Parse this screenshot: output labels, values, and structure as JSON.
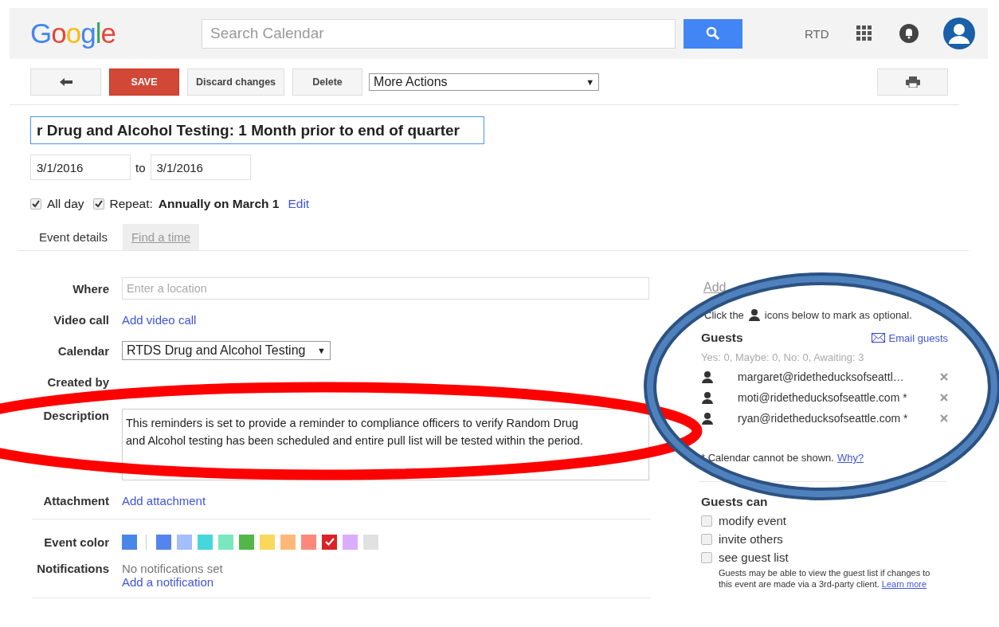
{
  "header": {
    "logo": "Google",
    "search": {
      "placeholder": "Search Calendar"
    },
    "user": "RTD"
  },
  "toolbar": {
    "save": "SAVE",
    "discard": "Discard changes",
    "delete": "Delete",
    "more_actions": "More Actions",
    "more_actions_caret": "▼"
  },
  "event": {
    "title": "r Drug and Alcohol Testing: 1 Month prior to end of quarter",
    "start_date": "3/1/2016",
    "to": "to",
    "end_date": "3/1/2016",
    "all_day": {
      "label": "All day",
      "checked": true
    },
    "repeat": {
      "label": "Repeat:",
      "checked": true,
      "value": "Annually on March 1",
      "edit": "Edit"
    }
  },
  "tabs": [
    {
      "label": "Event details",
      "selected": true
    },
    {
      "label": "Find a time",
      "selected": false
    }
  ],
  "details": {
    "where": {
      "label": "Where",
      "placeholder": "Enter a location"
    },
    "video_call": {
      "label": "Video call",
      "link": "Add video call"
    },
    "calendar": {
      "label": "Calendar",
      "value": "RTDS Drug and Alcohol Testing",
      "caret": "▼"
    },
    "created_by": {
      "label": "Created by"
    },
    "description": {
      "label": "Description",
      "value": "This reminders is set to provide a reminder to compliance officers to verify Random Drug and Alcohol testing has been scheduled and entire pull list will be tested within the period."
    },
    "attachment": {
      "label": "Attachment",
      "link": "Add attachment"
    },
    "event_color": {
      "label": "Event color",
      "current": {
        "color": "#4986e7"
      },
      "swatches": [
        {
          "color": "#5484ed",
          "selected": false
        },
        {
          "color": "#a4bdfc",
          "selected": false
        },
        {
          "color": "#46d6db",
          "selected": false
        },
        {
          "color": "#7ae7bf",
          "selected": false
        },
        {
          "color": "#51b749",
          "selected": false
        },
        {
          "color": "#fbd75b",
          "selected": false
        },
        {
          "color": "#ffb878",
          "selected": false
        },
        {
          "color": "#ff887c",
          "selected": false
        },
        {
          "color": "#dc2127",
          "selected": true
        },
        {
          "color": "#dbadff",
          "selected": false
        },
        {
          "color": "#e1e1e1",
          "selected": false
        }
      ]
    },
    "notifications": {
      "label": "Notifications",
      "status": "No notifications set",
      "link": "Add a notification"
    }
  },
  "guests_panel": {
    "add_link": "Add",
    "hint_before": "Click the",
    "hint_after": "icons below to mark as optional.",
    "title": "Guests",
    "email_link": "Email guests",
    "summary": "Yes: 0, Maybe: 0, No: 0, Awaiting: 3",
    "guests": [
      {
        "email": "margaret@ridetheducksofseattl…"
      },
      {
        "email": "moti@ridetheducksofseattle.com *"
      },
      {
        "email": "ryan@ridetheducksofseattle.com *"
      }
    ],
    "note": "* Calendar cannot be shown.",
    "why_link": "Why?",
    "permissions_title": "Guests can",
    "permissions": [
      {
        "label": "modify event",
        "checked": false
      },
      {
        "label": "invite others",
        "checked": false
      },
      {
        "label": "see guest list",
        "checked": false
      }
    ],
    "permission_note": "Guests may be able to view the guest list if changes to this event are made via a 3rd-party client.",
    "learn_more": "Learn more"
  }
}
